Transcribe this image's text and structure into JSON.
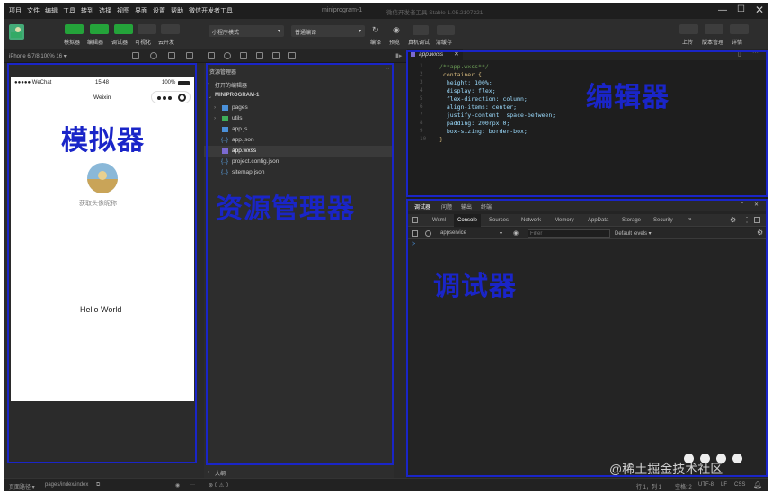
{
  "menu": [
    "项目",
    "文件",
    "编辑",
    "工具",
    "转到",
    "选择",
    "视图",
    "界面",
    "设置",
    "帮助",
    "微信开发者工具"
  ],
  "window_title": "miniprogram-1",
  "window_subtitle": "微信开发者工具 Stable 1.05.2107221",
  "toolbar": {
    "left_buttons": [
      "模拟器",
      "编辑器",
      "调试器",
      "可视化",
      "云开发"
    ],
    "mode_select": "小程序模式",
    "compile_select": "普通编译",
    "mid_buttons": [
      "编译",
      "预览",
      "真机调试",
      "清缓存"
    ],
    "right_buttons": [
      "上传",
      "版本管理",
      "详情"
    ]
  },
  "device_label": "iPhone 6/7/8 100% 16 ▾",
  "phone": {
    "carrier": "●●●●● WeChat",
    "time": "15:48",
    "battery": "100%",
    "nav_title": "Weixin",
    "tip": "获取头像昵称",
    "hello": "Hello World"
  },
  "explorer": {
    "header": "资源管理器",
    "open_editors": "打开的编辑器",
    "project": "MINIPROGRAM-1",
    "items": [
      {
        "name": "pages",
        "type": "folder"
      },
      {
        "name": "utils",
        "type": "folder"
      },
      {
        "name": "app.js",
        "type": "js"
      },
      {
        "name": "app.json",
        "type": "json"
      },
      {
        "name": "app.wxss",
        "type": "wxss"
      },
      {
        "name": "project.config.json",
        "type": "json"
      },
      {
        "name": "sitemap.json",
        "type": "json"
      }
    ],
    "outline": "大纲"
  },
  "editor": {
    "tab": "app.wxss",
    "lines": [
      "/**app.wxss**/",
      ".container {",
      "  height: 100%;",
      "  display: flex;",
      "  flex-direction: column;",
      "  align-items: center;",
      "  justify-content: space-between;",
      "  padding: 200rpx 0;",
      "  box-sizing: border-box;",
      "}"
    ]
  },
  "debugger": {
    "top_tabs": [
      "调试器",
      "问题",
      "输出",
      "终端"
    ],
    "tabs": [
      "Wxml",
      "Console",
      "Sources",
      "Network",
      "Memory",
      "AppData",
      "Storage",
      "Security"
    ],
    "more": "»",
    "context": "appservice",
    "filter_placeholder": "Filter",
    "levels": "Default levels ▾",
    "prompt": ">"
  },
  "status": {
    "page_path_label": "页面路径 ▾",
    "page_path": "pages/index/index",
    "problems": "⊗ 0 ⚠ 0",
    "cursor": "行 1，列 1",
    "spaces": "空格: 2",
    "encoding": "UTF-8",
    "eol": "LF",
    "lang": "CSS"
  },
  "annotations": {
    "simulator": "模拟器",
    "explorer": "资源管理器",
    "editor": "编辑器",
    "debugger": "调试器",
    "color": "#1a25c8"
  },
  "watermark": "@稀土掘金技术社区"
}
